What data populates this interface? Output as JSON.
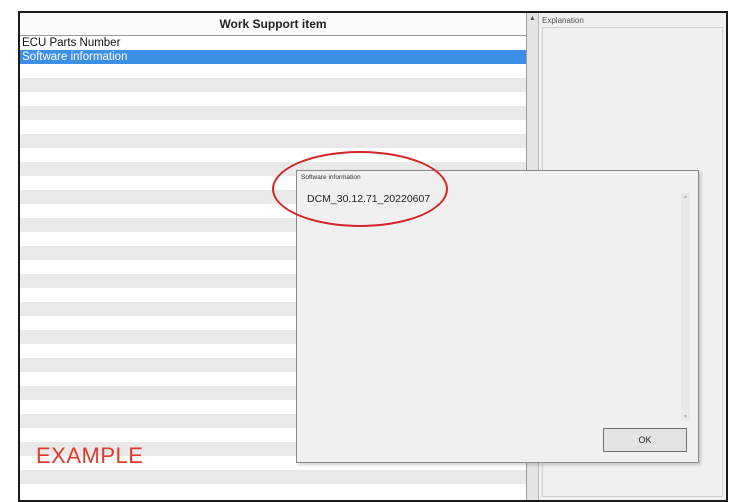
{
  "list": {
    "header": "Work Support item",
    "items": [
      "ECU Parts Number",
      "Software information"
    ],
    "selected_index": 1
  },
  "explanation": {
    "label": "Explanation"
  },
  "dialog": {
    "title": "Software information",
    "value": "DCM_30.12.71_20220607",
    "ok_label": "OK"
  },
  "overlay": {
    "example_text": "EXAMPLE"
  },
  "colors": {
    "selection": "#3d8ee6",
    "annotation": "#e23a2c"
  }
}
